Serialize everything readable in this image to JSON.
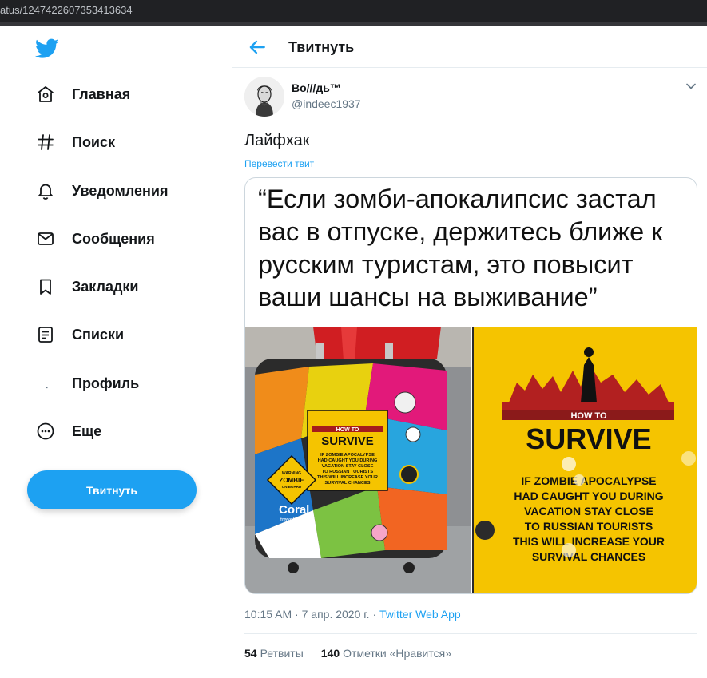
{
  "browser": {
    "url_fragment": "atus/1247422607353413634"
  },
  "sidebar": {
    "logo_icon": "twitter-bird-icon",
    "items": [
      {
        "label": "Главная",
        "icon": "home-icon"
      },
      {
        "label": "Поиск",
        "icon": "hashtag-icon"
      },
      {
        "label": "Уведомления",
        "icon": "bell-icon"
      },
      {
        "label": "Сообщения",
        "icon": "envelope-icon"
      },
      {
        "label": "Закладки",
        "icon": "bookmark-icon"
      },
      {
        "label": "Списки",
        "icon": "list-icon"
      },
      {
        "label": "Профиль",
        "icon": "profile-icon"
      },
      {
        "label": "Еще",
        "icon": "more-icon"
      }
    ],
    "tweet_button": "Твитнуть"
  },
  "header": {
    "title": "Твитнуть"
  },
  "tweet": {
    "author_name": "Bo///дь™",
    "author_handle": "@indeec1937",
    "text": "Лайфхак",
    "translate_link": "Перевести твит",
    "media_quote": "“Если зомби-апокалипсис застал вас в отпуске, держитесь ближе к русским туристам, это повысит ваши шансы на выживание”",
    "photo_sign": {
      "line1": "HOW TO",
      "line2": "SURVIVE",
      "body": [
        "IF ZOMBIE APOCALYPSE",
        "HAD CAUGHT YOU DURING",
        "VACATION STAY CLOSE",
        "TO RUSSIAN TOURISTS",
        "THIS WILL INCREASE YOUR",
        "SURVIVAL CHANCES"
      ],
      "small_body": [
        "IF ZOMBIE APOCALYPSE",
        "HAD CAUGHT YOU DURING",
        "VACATION STAY CLOSE",
        "TO RUSSIAN TOURISTS",
        "THIS WILL INCREASE YOUR",
        "SURVIVAL CHANCES"
      ],
      "warning_top": "WARNING",
      "warning_mid": "ZOMBIE",
      "warning_bottom": "ON BOARD",
      "brand": "Coral",
      "brand_sub": "travel"
    },
    "time": "10:15 AM",
    "date": "7 апр. 2020 г.",
    "source": "Twitter Web App",
    "retweets_count": "54",
    "retweets_label": "Ретвиты",
    "likes_count": "140",
    "likes_label": "Отметки «Нравится»"
  },
  "colors": {
    "accent": "#1da1f2",
    "text": "#14171a",
    "muted": "#657786",
    "border": "#e6ecf0",
    "sign_yellow": "#f5c400"
  }
}
